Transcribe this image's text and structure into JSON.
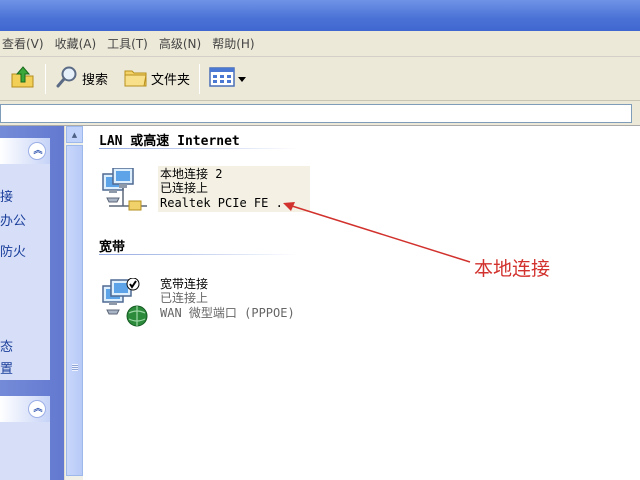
{
  "menubar": {
    "items": [
      "查看(V)",
      "收藏(A)",
      "工具(T)",
      "高级(N)",
      "帮助(H)"
    ]
  },
  "toolbar": {
    "search_label": "搜索",
    "folders_label": "文件夹"
  },
  "taskpane": {
    "links": [
      "接",
      "办公",
      "防火",
      "态",
      "置"
    ]
  },
  "groups": {
    "lan_header": "LAN 或高速 Internet",
    "broadband_header": "宽带"
  },
  "connections": {
    "local": {
      "name": "本地连接 2",
      "status": "已连接上",
      "device": "Realtek PCIe FE ."
    },
    "broadband": {
      "name": "宽带连接",
      "status": "已连接上",
      "device": "WAN 微型端口 (PPPOE)"
    }
  },
  "annotation": {
    "text": "本地连接",
    "color": "#d2322d"
  }
}
